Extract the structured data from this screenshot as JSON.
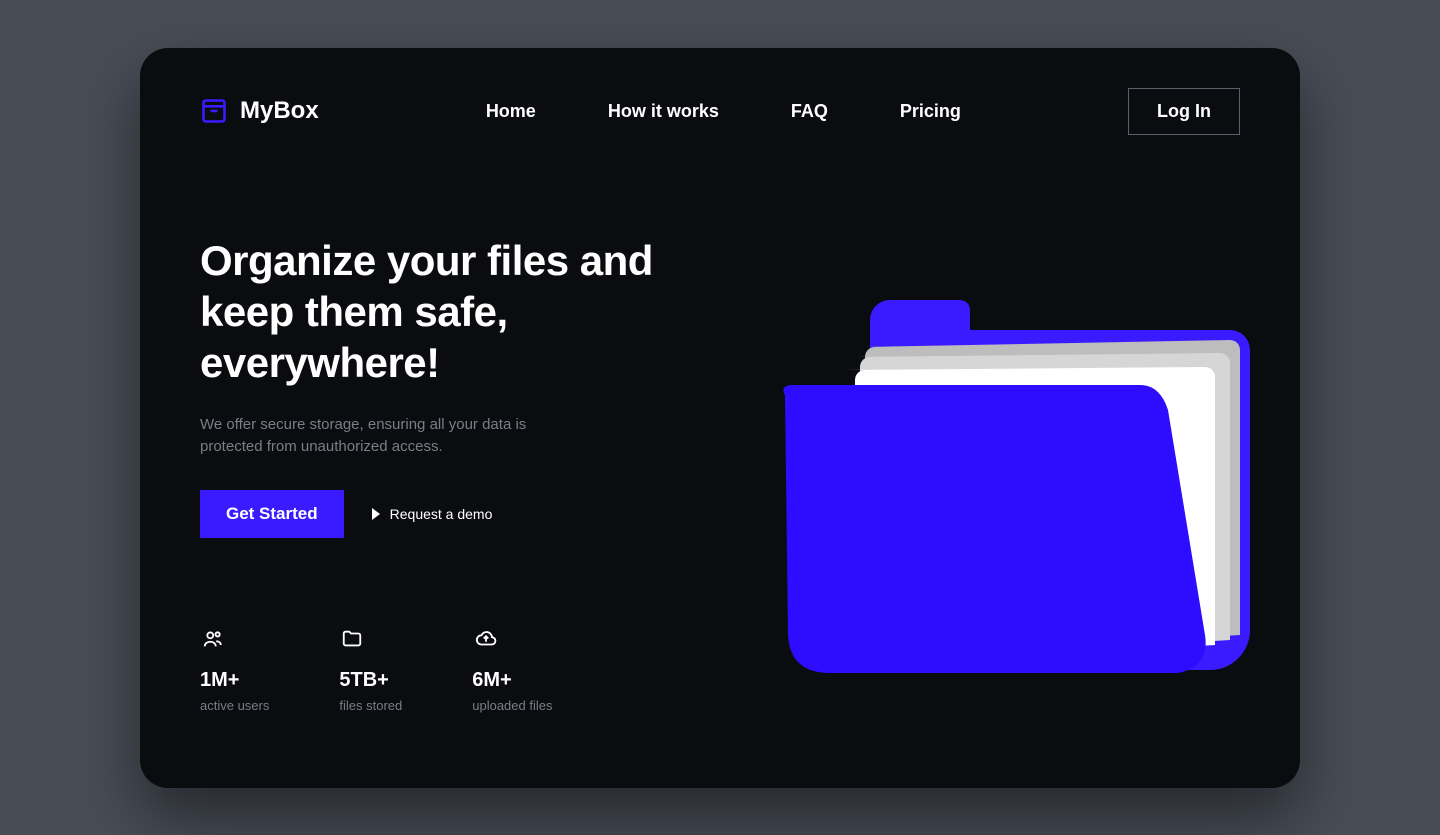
{
  "brand": {
    "name": "MyBox"
  },
  "nav": {
    "items": [
      "Home",
      "How it works",
      "FAQ",
      "Pricing"
    ]
  },
  "login_label": "Log In",
  "hero": {
    "headline": "Organize your files and keep them safe, everywhere!",
    "subhead": "We offer secure storage, ensuring all your data is protected from unauthorized access.",
    "primary_cta": "Get Started",
    "secondary_cta": "Request a demo"
  },
  "stats": [
    {
      "value": "1M+",
      "label": "active users",
      "icon": "users"
    },
    {
      "value": "5TB+",
      "label": "files stored",
      "icon": "folder"
    },
    {
      "value": "6M+",
      "label": "uploaded files",
      "icon": "cloud"
    }
  ],
  "colors": {
    "accent": "#3A1BFF",
    "bg_card": "#0B0C10",
    "bg_page": "#474C55"
  }
}
